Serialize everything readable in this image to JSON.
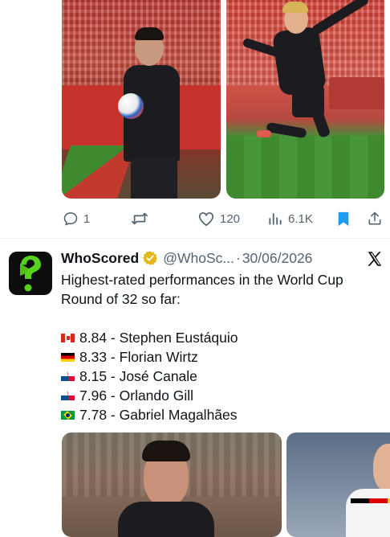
{
  "tweet_top": {
    "actions": {
      "replies": "1",
      "retweets": "",
      "likes": "120",
      "views": "6.1K"
    },
    "bookmark_color": "#1d9bf0"
  },
  "tweet_main": {
    "display_name": "WhoScored",
    "verified_badge_color": "#e2b719",
    "handle": "@WhoSc...",
    "separator": "·",
    "date": "30/06/2026",
    "intro_lines": [
      "Highest-rated performances in the World Cup",
      "Round of 32 so far:"
    ],
    "ratings": [
      {
        "flag": "canada",
        "rating": "8.84",
        "sep": " - ",
        "player": "Stephen Eustáquio"
      },
      {
        "flag": "germany",
        "rating": "8.33",
        "sep": " - ",
        "player": "Florian Wirtz"
      },
      {
        "flag": "panama",
        "rating": "8.15",
        "sep": " - ",
        "player": "José Canale"
      },
      {
        "flag": "panama",
        "rating": "7.96",
        "sep": " - ",
        "player": "Orlando Gill"
      },
      {
        "flag": "brazil",
        "rating": "7.78",
        "sep": " - ",
        "player": "Gabriel Magalhães"
      }
    ],
    "avatar_icon": "question-mark-icon",
    "avatar_accent": "#56d21c"
  },
  "icons": {
    "reply": "reply-icon",
    "retweet": "retweet-icon",
    "like": "heart-icon",
    "views": "analytics-icon",
    "bookmark": "bookmark-icon",
    "share": "share-icon",
    "x_logo": "x-logo-icon"
  }
}
